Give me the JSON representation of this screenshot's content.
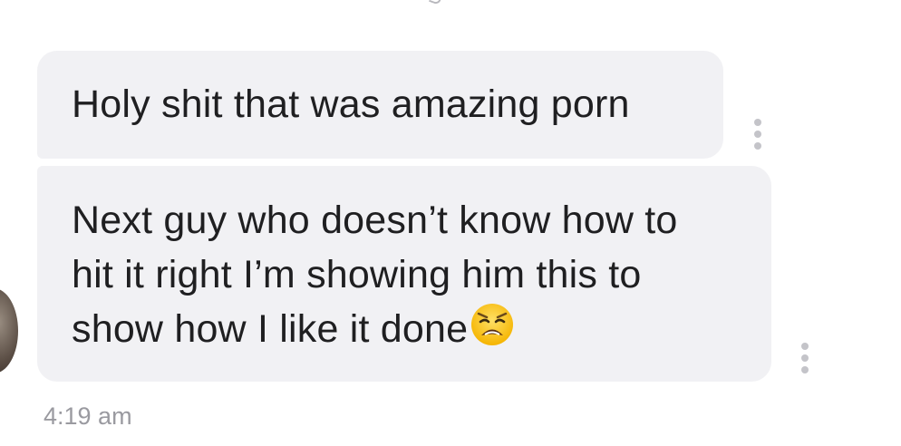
{
  "messages": [
    {
      "text": "Holy shit that was amazing porn"
    },
    {
      "lines": [
        "Next guy who doesn’t know how to",
        "hit it right I’m showing him this to",
        "show how I like it done"
      ],
      "emoji": "weary-face"
    }
  ],
  "timestamp": "4:19 am",
  "colors": {
    "bubble": "#f1f1f4",
    "text": "#1f1f21",
    "timestamp": "#9a9aa0",
    "menu_dots": "#c4c4c9"
  },
  "icons": {
    "message_menu": "more-vertical-icon",
    "sender_avatar": "avatar"
  }
}
